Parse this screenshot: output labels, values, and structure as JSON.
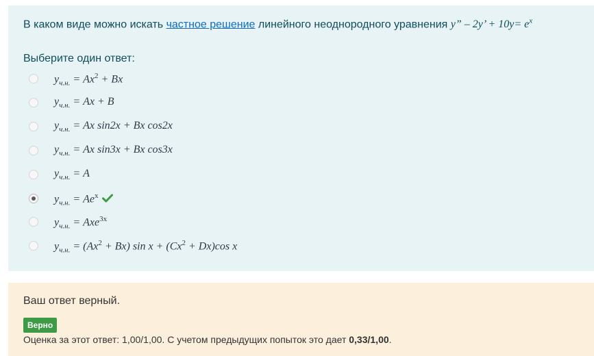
{
  "question": {
    "text_before": "В каком виде можно искать ",
    "link": "частное решение",
    "text_after": " линейного неоднородного уравнения ",
    "equation": "y” – 2y’ + 10y= e",
    "equation_sup": "x"
  },
  "prompt": "Выберите один ответ:",
  "options": [
    {
      "sub": "ч.н.",
      "text": " = Ax",
      "sup": "2",
      "tail": " + Bx",
      "selected": false
    },
    {
      "sub": "ч.н.",
      "text": " = Ax + B",
      "sup": "",
      "tail": "",
      "selected": false
    },
    {
      "sub": "ч.н.",
      "text": " = Ax sin2x + Bx cos2x",
      "sup": "",
      "tail": "",
      "selected": false
    },
    {
      "sub": "ч.н.",
      "text": " = Ax sin3x + Bx cos3x",
      "sup": "",
      "tail": "",
      "selected": false
    },
    {
      "sub": "ч.н.",
      "text": " = A",
      "sup": "",
      "tail": "",
      "selected": false
    },
    {
      "sub": "ч.н.",
      "text": " = Ae",
      "sup": "x",
      "tail": "",
      "selected": true
    },
    {
      "sub": "ч.н.",
      "text": " = Axe",
      "sup": "3x",
      "tail": "",
      "selected": false
    },
    {
      "sub": "ч.н.",
      "text": " = (Ax",
      "sup": "2",
      "tail": " + Bx) sin x + (Cx",
      "sup2": "2",
      "tail2": " + Dx)cos x",
      "selected": false
    }
  ],
  "feedback": {
    "message": "Ваш ответ верный.",
    "badge": "Верно",
    "grade_text": "Оценка за этот ответ: 1,00/1,00. С учетом предыдущих попыток это дает ",
    "grade_value": "0,33/1,00",
    "grade_end": "."
  },
  "colors": {
    "correct": "#3e9b45",
    "question_bg": "#e7f3f5",
    "feedback_bg": "#fcefdc",
    "link": "#0f6cbf"
  },
  "icons": {
    "correct_mark": "check-icon"
  }
}
